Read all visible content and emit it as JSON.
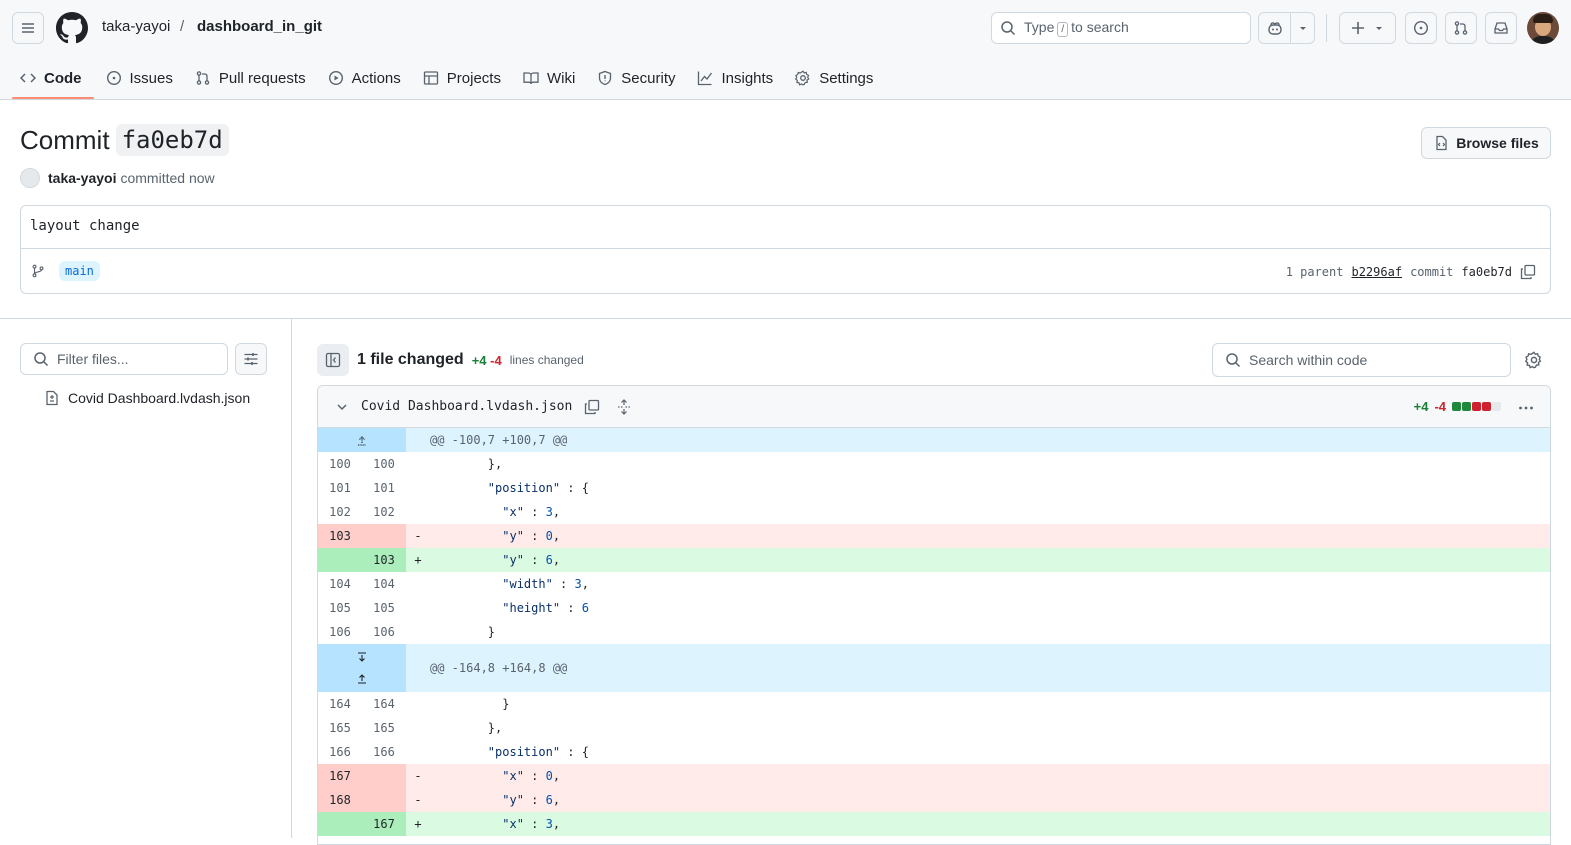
{
  "header": {
    "owner": "taka-yayoi",
    "separator": "/",
    "repo": "dashboard_in_git",
    "search_prefix": "Type",
    "search_key": "/",
    "search_suffix": "to search"
  },
  "tabs": [
    {
      "label": "Code",
      "icon": "code-icon"
    },
    {
      "label": "Issues",
      "icon": "issue-icon"
    },
    {
      "label": "Pull requests",
      "icon": "pull-request-icon"
    },
    {
      "label": "Actions",
      "icon": "play-icon"
    },
    {
      "label": "Projects",
      "icon": "table-icon"
    },
    {
      "label": "Wiki",
      "icon": "book-icon"
    },
    {
      "label": "Security",
      "icon": "shield-icon"
    },
    {
      "label": "Insights",
      "icon": "graph-icon"
    },
    {
      "label": "Settings",
      "icon": "gear-icon"
    }
  ],
  "commit": {
    "title_prefix": "Commit",
    "hash": "fa0eb7d",
    "author": "taka-yayoi",
    "when": "committed now",
    "browse_label": "Browse files",
    "message": "layout change",
    "branch": "main",
    "parent_label": "1 parent",
    "parent_hash": "b2296af",
    "commit_label": "commit",
    "commit_hash": "fa0eb7d"
  },
  "files_panel": {
    "filter_placeholder": "Filter files...",
    "file_name": "Covid Dashboard.lvdash.json"
  },
  "summary": {
    "changed": "1 file changed",
    "additions": "+4",
    "deletions": "-4",
    "lines_changed": "lines changed",
    "search_placeholder": "Search within code"
  },
  "file": {
    "name": "Covid Dashboard.lvdash.json",
    "additions": "+4",
    "deletions": "-4"
  },
  "hunk1": "@@ -100,7 +100,7 @@",
  "hunk2": "@@ -164,8 +164,8 @@",
  "colors": {
    "added": "#dafbe1",
    "deleted": "#ffebe9",
    "hunk": "#ddf4ff",
    "tab_underline": "#fd8c73"
  }
}
